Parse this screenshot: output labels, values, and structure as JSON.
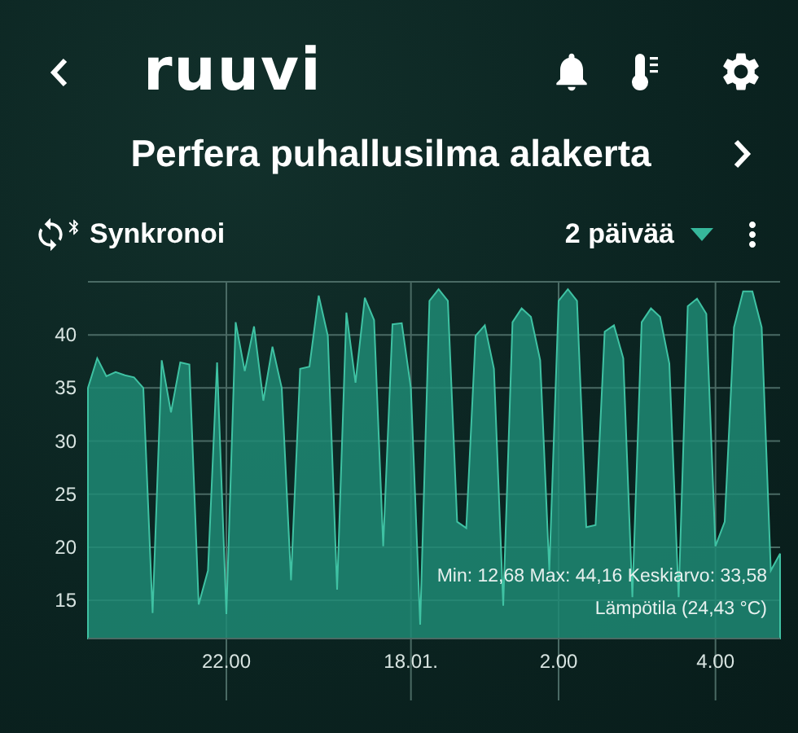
{
  "header": {
    "logo": "ruuvi"
  },
  "sensor": {
    "name": "Perfera puhallusilma alakerta"
  },
  "toolbar": {
    "sync_label": "Synkronoi",
    "period": "2 päivää"
  },
  "chart": {
    "stats": "Min: 12,68 Max: 44,16 Keskiarvo: 33,58",
    "legend": "Lämpötila (24,43 °C)",
    "chart_data": {
      "type": "area",
      "grid": true,
      "ylim": [
        11.4,
        45
      ],
      "yticks": [
        15,
        20,
        25,
        30,
        35,
        40
      ],
      "categories": [
        null,
        null,
        null,
        null,
        null,
        null,
        null,
        null,
        null,
        null,
        null,
        null,
        null,
        null,
        null,
        "22.00",
        null,
        null,
        null,
        null,
        null,
        null,
        null,
        null,
        null,
        null,
        null,
        null,
        null,
        null,
        null,
        null,
        null,
        null,
        null,
        "18.01.",
        null,
        null,
        null,
        null,
        null,
        null,
        null,
        null,
        null,
        null,
        null,
        null,
        null,
        null,
        null,
        "2.00",
        null,
        null,
        null,
        null,
        null,
        null,
        null,
        null,
        null,
        null,
        null,
        null,
        null,
        null,
        null,
        null,
        "4.00",
        null,
        null,
        null,
        null,
        null,
        null,
        null
      ],
      "series": [
        {
          "color": "#1f8a74",
          "values": [
            35.0,
            37.8,
            36.1,
            36.5,
            36.2,
            36.0,
            35.0,
            13.8,
            37.6,
            32.7,
            37.4,
            37.2,
            14.6,
            17.8,
            37.4,
            13.7,
            41.2,
            36.6,
            40.8,
            33.8,
            38.9,
            35.0,
            16.9,
            36.8,
            37.0,
            43.7,
            39.9,
            16.0,
            42.1,
            35.5,
            43.5,
            41.4,
            20.1,
            41.0,
            41.1,
            35.0,
            12.7,
            43.2,
            44.3,
            43.2,
            22.4,
            21.8,
            39.9,
            40.9,
            36.8,
            14.5,
            41.2,
            42.5,
            41.7,
            37.6,
            17.8,
            43.2,
            44.3,
            43.2,
            21.9,
            22.1,
            40.3,
            40.9,
            37.8,
            15.3,
            41.2,
            42.5,
            41.7,
            37.3,
            15.3,
            42.7,
            43.4,
            42.0,
            20.1,
            22.4,
            40.7,
            44.1,
            44.1,
            40.7,
            17.8,
            19.4
          ]
        }
      ]
    }
  }
}
